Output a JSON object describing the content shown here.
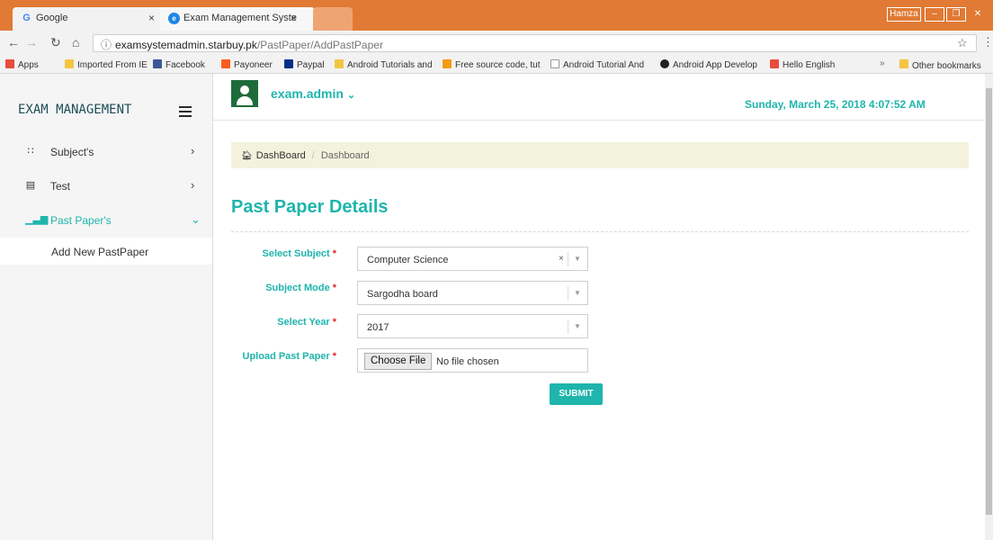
{
  "browser": {
    "tabs": [
      {
        "label": "Google",
        "icon": "google-icon"
      },
      {
        "label": "Exam Management Syste",
        "icon": "edge-icon"
      }
    ],
    "window_user": "Hamza",
    "address": {
      "host": "examsystemadmin.starbuy.pk",
      "path": "/PastPaper/AddPastPaper"
    },
    "bookmarks": [
      {
        "label": "Apps",
        "color": "#e74c3c"
      },
      {
        "label": "Imported From IE",
        "color": "#f4c542"
      },
      {
        "label": "Facebook",
        "color": "#3b5998"
      },
      {
        "label": "Payoneer",
        "color": "#ff5a1f"
      },
      {
        "label": "Paypal",
        "color": "#003087"
      },
      {
        "label": "Android Tutorials and",
        "color": "#f4c542"
      },
      {
        "label": "Free source code, tut",
        "color": "#f39c12"
      },
      {
        "label": "Android Tutorial And",
        "color": "#bbbbbb"
      },
      {
        "label": "Android App Develop",
        "color": "#222222"
      },
      {
        "label": "Hello English",
        "color": "#e74c3c"
      }
    ],
    "more": "»",
    "other_bookmarks": "Other bookmarks"
  },
  "sidebar": {
    "brand": "EXAM MANAGEMENT",
    "items": [
      {
        "label": "Subject's",
        "icon": "grid-icon",
        "chevron": "›"
      },
      {
        "label": "Test",
        "icon": "list-icon",
        "chevron": "›"
      },
      {
        "label": "Past Paper's",
        "icon": "bar-chart-icon",
        "chevron": "⌄"
      }
    ],
    "sub_item": "Add New PastPaper"
  },
  "header": {
    "username": "exam.admin",
    "datetime": "Sunday, March 25, 2018 4:07:52 AM"
  },
  "breadcrumb": {
    "home": "DashBoard",
    "current": "Dashboard"
  },
  "page_title": "Past Paper Details",
  "form": {
    "subject_label": "Select Subject",
    "subject_value": "Computer Science",
    "mode_label": "Subject Mode",
    "mode_value": "Sargodha board",
    "year_label": "Select Year",
    "year_value": "2017",
    "upload_label": "Upload Past Paper",
    "choose_file": "Choose File",
    "file_status": "No file chosen",
    "required_mark": "*",
    "submit": "SUBMIT"
  },
  "colors": {
    "accent": "#1fb5ac",
    "chrome": "#e07a34",
    "breadcrumb_bg": "#f3f2dc",
    "required": "#e02424"
  }
}
